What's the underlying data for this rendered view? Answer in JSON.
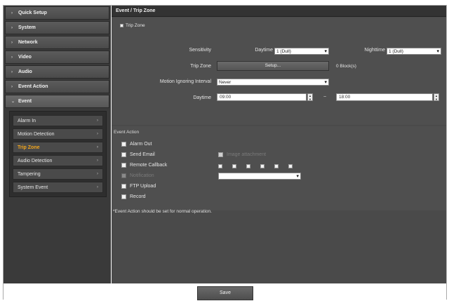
{
  "sidebar": {
    "items": [
      {
        "label": "Quick Setup",
        "arrow": "›"
      },
      {
        "label": "System",
        "arrow": "›"
      },
      {
        "label": "Network",
        "arrow": "›"
      },
      {
        "label": "Video",
        "arrow": "›"
      },
      {
        "label": "Audio",
        "arrow": "›"
      },
      {
        "label": "Event Action",
        "arrow": "›"
      },
      {
        "label": "Event",
        "arrow": "⌄"
      }
    ],
    "subitems": [
      {
        "label": "Alarm In"
      },
      {
        "label": "Motion Detection"
      },
      {
        "label": "Trip Zone"
      },
      {
        "label": "Audio Detection"
      },
      {
        "label": "Tampering"
      },
      {
        "label": "System Event"
      }
    ]
  },
  "main": {
    "title": "Event / Trip Zone",
    "tripzone": {
      "enable_label": "Trip Zone",
      "sensitivity_label": "Sensitivity",
      "daytime_label": "Daytime",
      "daytime_value": "1 (Dull)",
      "nighttime_label": "Nighttime",
      "nighttime_value": "1 (Dull)",
      "tripzone_label": "Trip Zone",
      "setup_button": "Setup...",
      "blocks_text": "0 Block(s)",
      "motion_interval_label": "Motion Ignoring Interval",
      "motion_interval_value": "Never",
      "daytime2_label": "Daytime",
      "time_start": "09:00",
      "time_end": "18:00",
      "tilde": "~"
    },
    "event_action": {
      "title": "Event Action",
      "alarm_out": "Alarm Out",
      "send_email": "Send Email",
      "send_email_option": "Image attachment",
      "remote_callback": "Remote Callback",
      "dimmed_label": "Notification",
      "ftp_upload": "FTP Upload",
      "record": "Record"
    },
    "note": "*Event Action should be set for normal operation."
  },
  "footer": {
    "save_label": "Save"
  }
}
